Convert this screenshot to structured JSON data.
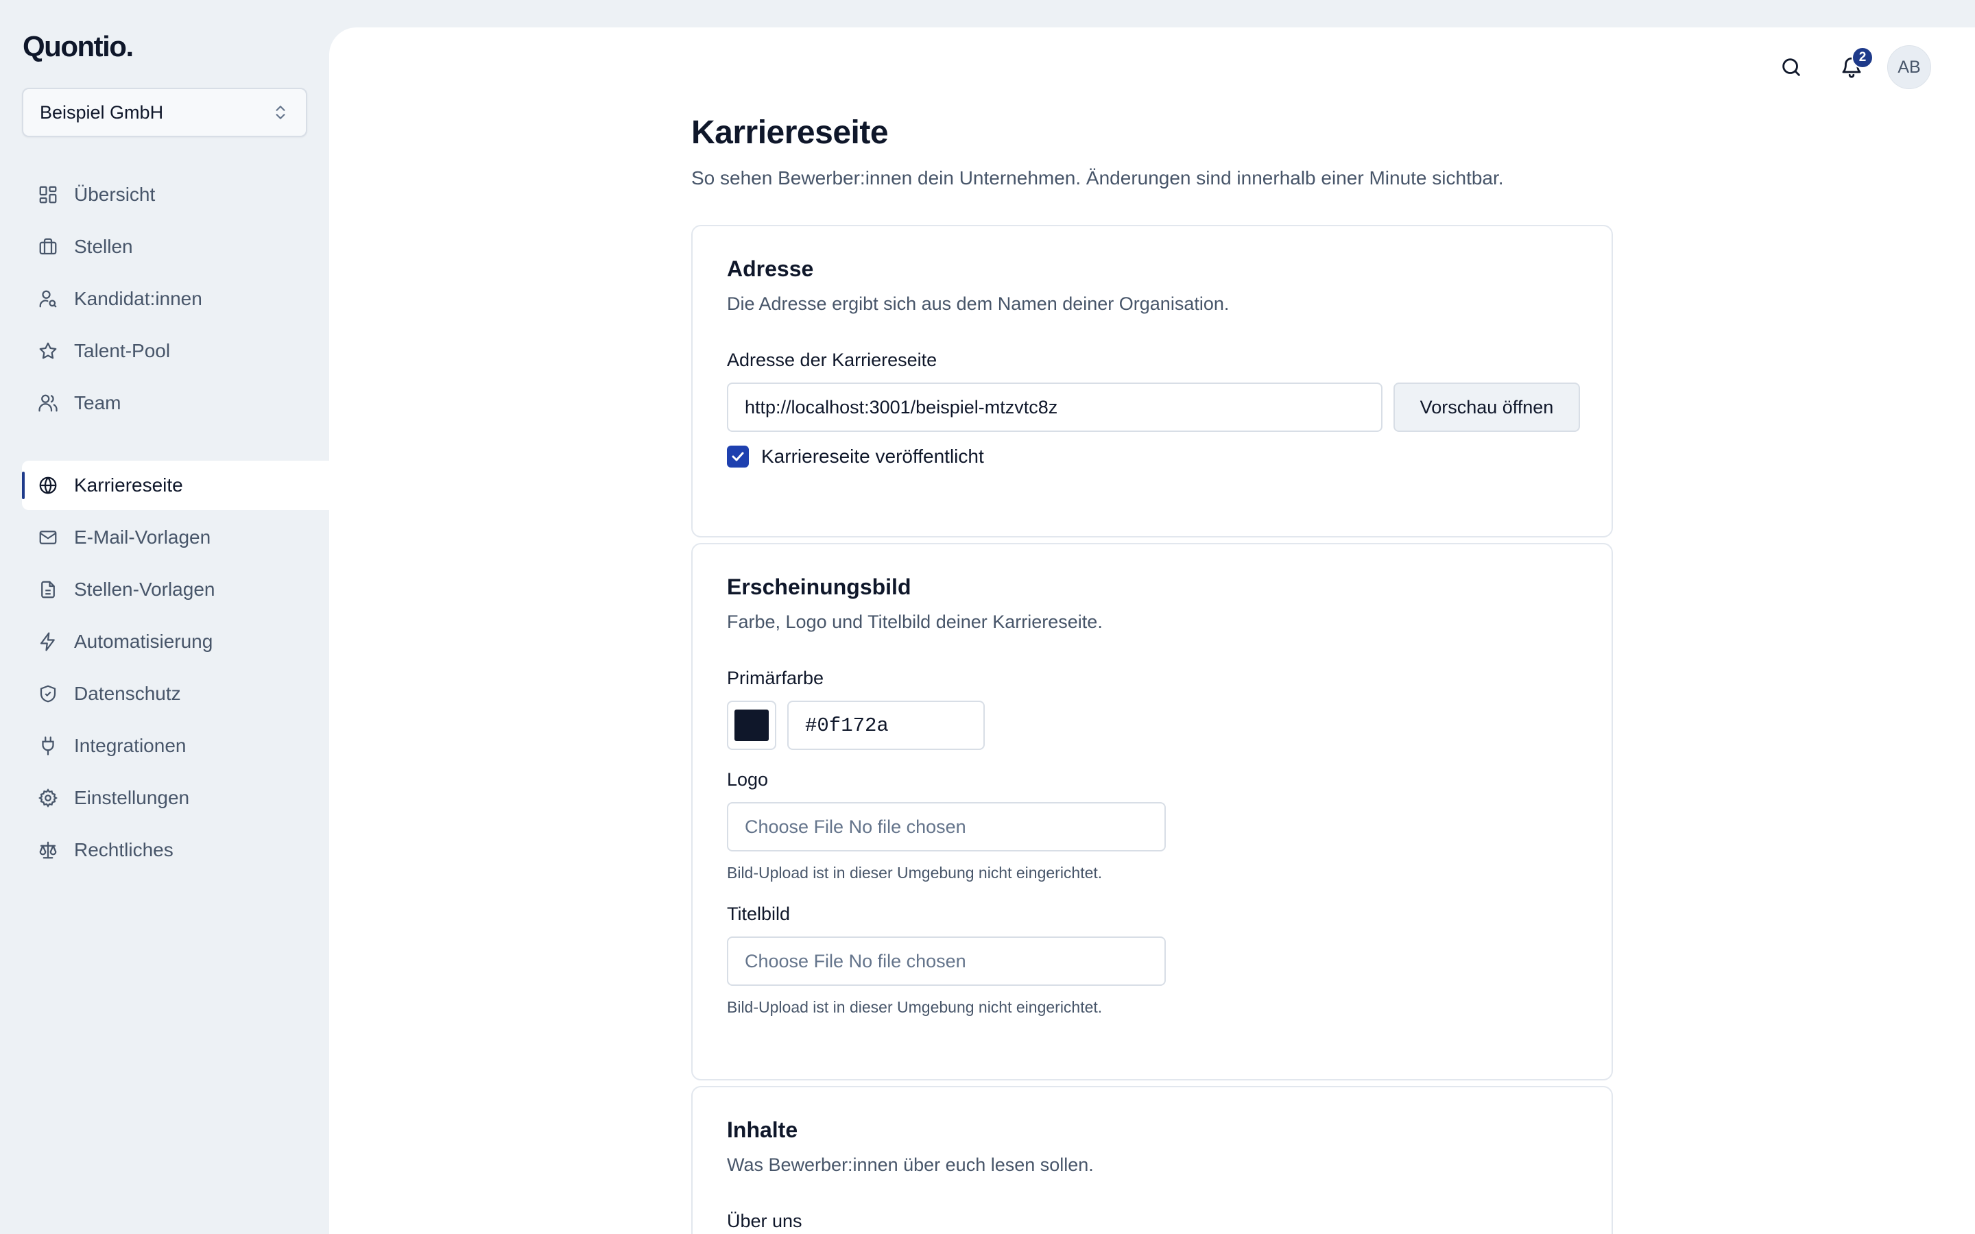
{
  "brand": {
    "logo_text": "Quontio."
  },
  "org_switcher": {
    "selected": "Beispiel GmbH"
  },
  "sidebar": {
    "group1": [
      {
        "label": "Übersicht",
        "icon": "dashboard-icon"
      },
      {
        "label": "Stellen",
        "icon": "briefcase-icon"
      },
      {
        "label": "Kandidat:innen",
        "icon": "user-search-icon"
      },
      {
        "label": "Talent-Pool",
        "icon": "star-icon"
      },
      {
        "label": "Team",
        "icon": "users-icon"
      }
    ],
    "group2": [
      {
        "label": "Karriereseite",
        "icon": "globe-icon",
        "active": true
      },
      {
        "label": "E-Mail-Vorlagen",
        "icon": "mail-icon"
      },
      {
        "label": "Stellen-Vorlagen",
        "icon": "file-text-icon"
      },
      {
        "label": "Automatisierung",
        "icon": "zap-icon"
      },
      {
        "label": "Datenschutz",
        "icon": "shield-check-icon"
      },
      {
        "label": "Integrationen",
        "icon": "plug-icon"
      },
      {
        "label": "Einstellungen",
        "icon": "gear-icon"
      },
      {
        "label": "Rechtliches",
        "icon": "scale-icon"
      }
    ]
  },
  "topbar": {
    "notification_count": "2",
    "avatar_initials": "AB"
  },
  "page": {
    "title": "Karriereseite",
    "subtitle": "So sehen Bewerber:innen dein Unternehmen. Änderungen sind innerhalb einer Minute sichtbar."
  },
  "address_card": {
    "title": "Adresse",
    "description": "Die Adresse ergibt sich aus dem Namen deiner Organisation.",
    "field_label": "Adresse der Karriereseite",
    "url_value": "http://localhost:3001/beispiel-mtzvtc8z",
    "preview_button": "Vorschau öffnen",
    "published_label": "Karriereseite veröffentlicht",
    "published_checked": true
  },
  "appearance_card": {
    "title": "Erscheinungsbild",
    "description": "Farbe, Logo und Titelbild deiner Karriereseite.",
    "primary_color_label": "Primärfarbe",
    "primary_color_value": "#0f172a",
    "logo_label": "Logo",
    "logo_file_text": "Choose File No file chosen",
    "logo_help": "Bild-Upload ist in dieser Umgebung nicht eingerichtet.",
    "cover_label": "Titelbild",
    "cover_file_text": "Choose File No file chosen",
    "cover_help": "Bild-Upload ist in dieser Umgebung nicht eingerichtet."
  },
  "content_card": {
    "title": "Inhalte",
    "description": "Was Bewerber:innen über euch lesen sollen.",
    "about_label": "Über uns"
  },
  "colors": {
    "accent": "#1e3a8a",
    "checkbox": "#1e40af",
    "text": "#0f172a",
    "muted": "#475569"
  }
}
